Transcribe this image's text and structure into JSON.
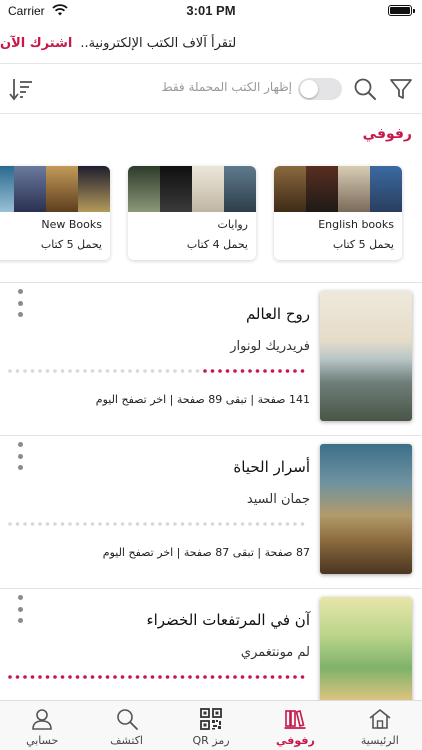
{
  "status": {
    "carrier": "Carrier",
    "time": "3:01 PM"
  },
  "promo": {
    "text": "لتقرأ آلاف الكتب الإلكترونية..",
    "cta": "اشترك الآن"
  },
  "toolbar": {
    "toggle_label": "إظهار الكتب المحملة فقط",
    "toggle_on": false
  },
  "section": {
    "title": "رفوفي"
  },
  "shelves": [
    {
      "name": "English books",
      "count": "يحمل 5 كتاب"
    },
    {
      "name": "روايات",
      "count": "يحمل 4 كتاب"
    },
    {
      "name": "New Books",
      "count": "يحمل 5 كتاب"
    }
  ],
  "books": [
    {
      "title": "روح العالم",
      "author": "فريدريك لونوار",
      "stats": "141 صفحة | تبقى 89 صفحة | اخر تصفح اليوم",
      "progress": 0.37
    },
    {
      "title": "أسرار الحياة",
      "author": "جمان السيد",
      "stats": "87 صفحة | تبقى 87 صفحة | اخر تصفح اليوم",
      "progress": 0.0
    },
    {
      "title": "آن في المرتفعات الخضراء",
      "author": "لم مونتغمري",
      "stats": "",
      "progress": 1.0
    }
  ],
  "tabs": [
    {
      "label": "الرئيسية",
      "icon": "home-icon",
      "active": false
    },
    {
      "label": "رفوفي",
      "icon": "shelves-icon",
      "active": true
    },
    {
      "label": "رمز QR",
      "icon": "qr-code-icon",
      "active": false
    },
    {
      "label": "اكتشف",
      "icon": "search-icon",
      "active": false
    },
    {
      "label": "حسابي",
      "icon": "person-icon",
      "active": false
    }
  ],
  "colors": {
    "accent": "#c7184a",
    "track": "#d8d8d8"
  }
}
